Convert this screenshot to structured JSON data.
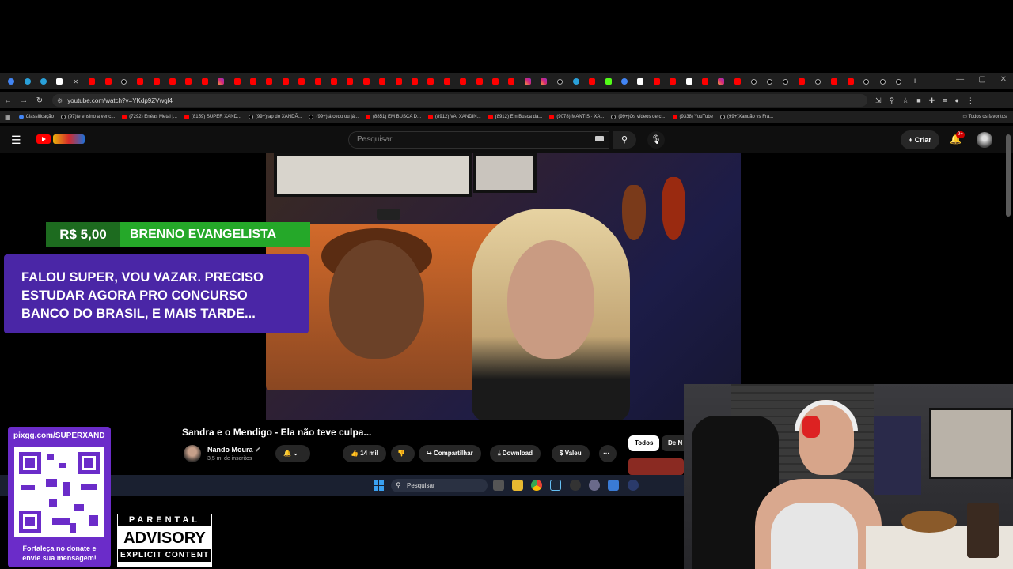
{
  "browser": {
    "url": "youtube.com/watch?v=YKdp9ZVwgl4",
    "bookmarks": [
      {
        "label": "Classificação",
        "icon": "g"
      },
      {
        "label": "(97)te ensino a venc...",
        "icon": "tk"
      },
      {
        "label": "(7292) Enéas Metal |...",
        "icon": "yt"
      },
      {
        "label": "(8159) SUPER XAND...",
        "icon": "yt"
      },
      {
        "label": "(99+)rap do XANDÃ...",
        "icon": "tk"
      },
      {
        "label": "(99+)tá cedo ou já...",
        "icon": "tk"
      },
      {
        "label": "(8851) EM BUSCA D...",
        "icon": "yt"
      },
      {
        "label": "(8912) VAI XANDIN...",
        "icon": "yt"
      },
      {
        "label": "(8912) Em Busca da...",
        "icon": "yt"
      },
      {
        "label": "(9078) MANTIS · XA...",
        "icon": "yt"
      },
      {
        "label": "(99+)Os vídeos de c...",
        "icon": "tk"
      },
      {
        "label": "(9338) YouTube",
        "icon": "yt"
      },
      {
        "label": "(99+)Xandão vs Fra...",
        "icon": "tk"
      }
    ],
    "all_bookmarks_label": "Todos os favoritos",
    "tab_icons": [
      "g",
      "tg",
      "tg",
      "w",
      "x",
      "yt",
      "yt",
      "tk",
      "yt",
      "yt",
      "yt",
      "yt",
      "yt",
      "ig",
      "yt",
      "yt",
      "yt",
      "yt",
      "yt",
      "yt",
      "yt",
      "yt",
      "yt",
      "yt",
      "yt",
      "yt",
      "yt",
      "yt",
      "yt",
      "yt",
      "yt",
      "yt",
      "ig",
      "ig",
      "tk",
      "tg",
      "yt",
      "k",
      "g",
      "w",
      "yt",
      "yt",
      "w",
      "yt",
      "ig",
      "yt",
      "tk",
      "tk",
      "tk",
      "yt",
      "tk",
      "yt",
      "yt",
      "tk",
      "tk",
      "tk"
    ]
  },
  "youtube": {
    "search_placeholder": "Pesquisar",
    "create_label": "Criar",
    "notification_count": "9+",
    "video": {
      "title": "Sandra e o Mendigo - Ela não teve culpa...",
      "channel": "Nando Moura",
      "subscribers": "3,5 mi de inscritos",
      "likes": "14 mil",
      "share_label": "Compartilhar",
      "download_label": "Download",
      "thanks_label": "Valeu"
    },
    "chips": [
      "Todos",
      "De N"
    ]
  },
  "donation": {
    "amount": "R$ 5,00",
    "donor": "BRENNO EVANGELISTA",
    "message_lines": [
      "FALOU SUPER, VOU VAZAR. PRECISO",
      "ESTUDAR AGORA PRO CONCURSO",
      "BANCO DO BRASIL, E MAIS TARDE..."
    ]
  },
  "taskbar": {
    "search_label": "Pesquisar"
  },
  "stream_overlay": {
    "qr_url": "pixgg.com/SUPERXAND",
    "qr_caption_lines": [
      "Fortaleça no donate e",
      "envie sua mensagem!"
    ],
    "parental_top": "PARENTAL",
    "parental_mid": "ADVISORY",
    "parental_bot": "EXPLICIT CONTENT"
  },
  "colors": {
    "youtube_red": "#ff0000",
    "donation_green": "#25a829",
    "donation_purple": "#4a26a6",
    "qr_purple": "#6b2cc9"
  }
}
